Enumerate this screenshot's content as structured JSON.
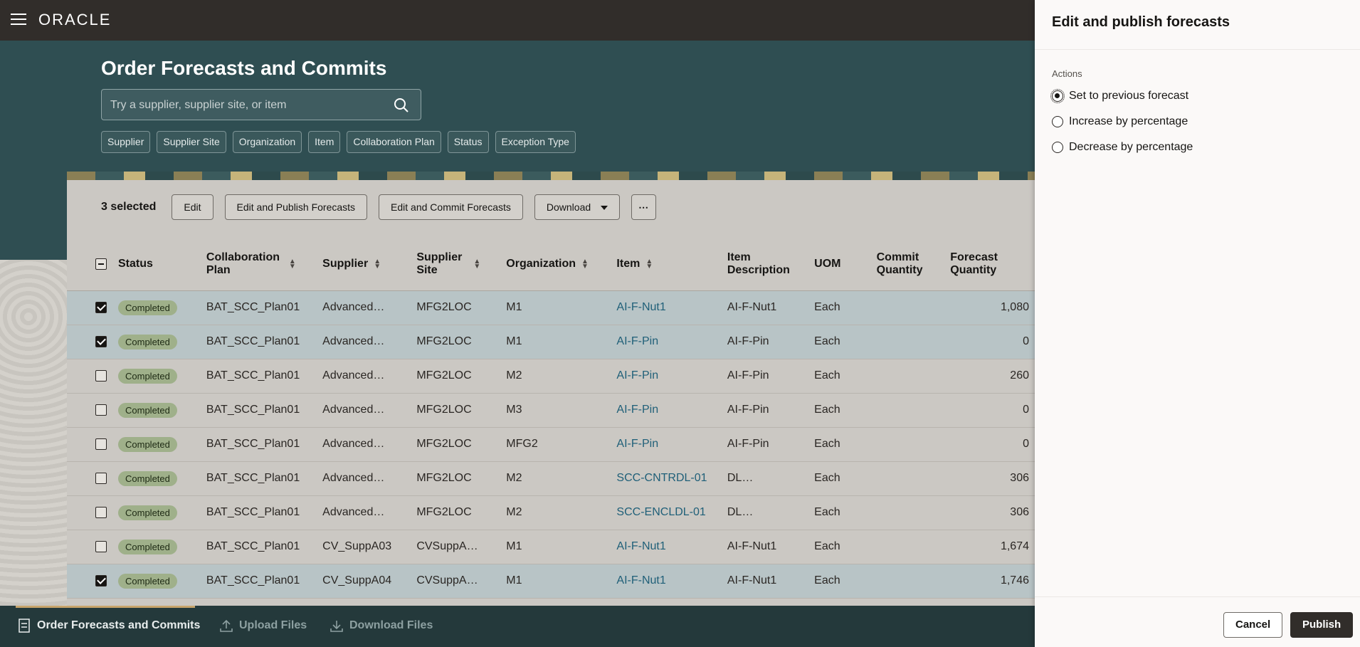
{
  "topbar": {
    "logo": "ORACLE"
  },
  "page": {
    "title": "Order Forecasts and Commits",
    "search_placeholder": "Try a supplier, supplier site, or item",
    "filters": [
      "Supplier",
      "Supplier Site",
      "Organization",
      "Item",
      "Collaboration Plan",
      "Status",
      "Exception Type"
    ]
  },
  "toolbar": {
    "selected": "3 selected",
    "edit": "Edit",
    "edit_publish": "Edit and Publish Forecasts",
    "edit_commit": "Edit and Commit Forecasts",
    "download": "Download",
    "more": "⋯"
  },
  "table": {
    "headers": {
      "status": "Status",
      "plan": "Collaboration Plan",
      "supplier": "Supplier",
      "site": "Supplier Site",
      "org": "Organization",
      "item": "Item",
      "desc": "Item Description",
      "uom": "UOM",
      "commit": "Commit Quantity",
      "forecast": "Forecast Quantity"
    },
    "rows": [
      {
        "checked": true,
        "status": "Completed",
        "plan": "BAT_SCC_Plan01",
        "supplier": "Advanced…",
        "site": "MFG2LOC",
        "org": "M1",
        "item": "AI-F-Nut1",
        "desc": "AI-F-Nut1",
        "uom": "Each",
        "commit": "",
        "forecast": "1,080"
      },
      {
        "checked": true,
        "status": "Completed",
        "plan": "BAT_SCC_Plan01",
        "supplier": "Advanced…",
        "site": "MFG2LOC",
        "org": "M1",
        "item": "AI-F-Pin",
        "desc": "AI-F-Pin",
        "uom": "Each",
        "commit": "",
        "forecast": "0"
      },
      {
        "checked": false,
        "status": "Completed",
        "plan": "BAT_SCC_Plan01",
        "supplier": "Advanced…",
        "site": "MFG2LOC",
        "org": "M2",
        "item": "AI-F-Pin",
        "desc": "AI-F-Pin",
        "uom": "Each",
        "commit": "",
        "forecast": "260"
      },
      {
        "checked": false,
        "status": "Completed",
        "plan": "BAT_SCC_Plan01",
        "supplier": "Advanced…",
        "site": "MFG2LOC",
        "org": "M3",
        "item": "AI-F-Pin",
        "desc": "AI-F-Pin",
        "uom": "Each",
        "commit": "",
        "forecast": "0"
      },
      {
        "checked": false,
        "status": "Completed",
        "plan": "BAT_SCC_Plan01",
        "supplier": "Advanced…",
        "site": "MFG2LOC",
        "org": "MFG2",
        "item": "AI-F-Pin",
        "desc": "AI-F-Pin",
        "uom": "Each",
        "commit": "",
        "forecast": "0"
      },
      {
        "checked": false,
        "status": "Completed",
        "plan": "BAT_SCC_Plan01",
        "supplier": "Advanced…",
        "site": "MFG2LOC",
        "org": "M2",
        "item": "SCC-CNTRDL-01",
        "desc": "DL…",
        "uom": "Each",
        "commit": "",
        "forecast": "306"
      },
      {
        "checked": false,
        "status": "Completed",
        "plan": "BAT_SCC_Plan01",
        "supplier": "Advanced…",
        "site": "MFG2LOC",
        "org": "M2",
        "item": "SCC-ENCLDL-01",
        "desc": "DL…",
        "uom": "Each",
        "commit": "",
        "forecast": "306"
      },
      {
        "checked": false,
        "status": "Completed",
        "plan": "BAT_SCC_Plan01",
        "supplier": "CV_SuppA03",
        "site": "CVSuppA…",
        "org": "M1",
        "item": "AI-F-Nut1",
        "desc": "AI-F-Nut1",
        "uom": "Each",
        "commit": "",
        "forecast": "1,674"
      },
      {
        "checked": true,
        "status": "Completed",
        "plan": "BAT_SCC_Plan01",
        "supplier": "CV_SuppA04",
        "site": "CVSuppA…",
        "org": "M1",
        "item": "AI-F-Nut1",
        "desc": "AI-F-Nut1",
        "uom": "Each",
        "commit": "",
        "forecast": "1,746"
      }
    ]
  },
  "bottom_nav": [
    {
      "label": "Order Forecasts and Commits",
      "icon": "forecast-icon",
      "active": true
    },
    {
      "label": "Upload Files",
      "icon": "upload-icon",
      "active": false
    },
    {
      "label": "Download Files",
      "icon": "download-icon",
      "active": false
    }
  ],
  "drawer": {
    "title": "Edit and publish forecasts",
    "actions_label": "Actions",
    "options": [
      {
        "label": "Set to previous forecast",
        "selected": true
      },
      {
        "label": "Increase by percentage",
        "selected": false
      },
      {
        "label": "Decrease by percentage",
        "selected": false
      }
    ],
    "cancel": "Cancel",
    "publish": "Publish"
  },
  "colors": {
    "topbar": "#312d2a",
    "hero": "#2f4e52",
    "link": "#1f5f78",
    "badge": "#9fb08a",
    "selected_row": "#b8c4c6"
  }
}
